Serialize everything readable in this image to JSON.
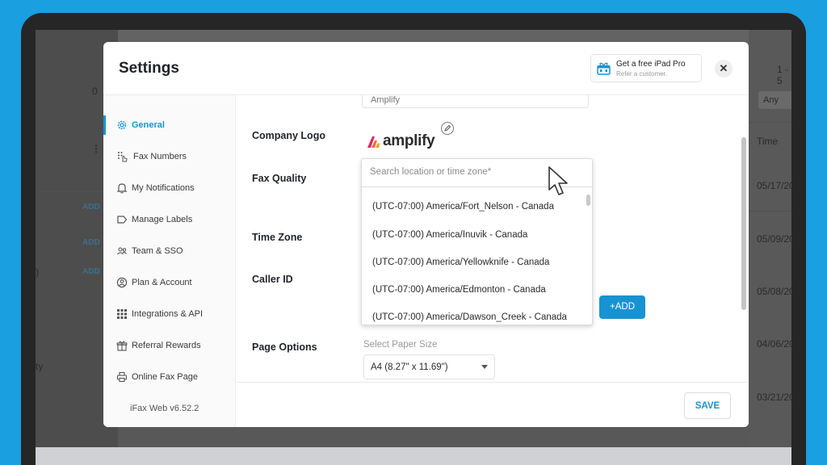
{
  "background_app": {
    "left_number": "0",
    "page_range": "1 - 5",
    "filter_label": "Any",
    "time_header": "Time",
    "add_links": [
      "ADD",
      "ADD",
      "ADD"
    ],
    "left_fragments": [
      ")",
      "ty"
    ],
    "dates": [
      "05/17/20",
      "05/09/20",
      "05/08/20",
      "04/06/20",
      "03/21/20"
    ]
  },
  "modal": {
    "title": "Settings",
    "promo": {
      "title": "Get a free iPad Pro",
      "subtitle": "Refer a customer."
    },
    "close_label": "✕"
  },
  "sidebar": {
    "items": [
      {
        "label": "General",
        "icon": "gear-icon",
        "active": true
      },
      {
        "label": "Fax Numbers",
        "icon": "keypad-hand-icon"
      },
      {
        "label": "My Notifications",
        "icon": "bell-icon"
      },
      {
        "label": "Manage Labels",
        "icon": "tag-icon"
      },
      {
        "label": "Team & SSO",
        "icon": "users-icon"
      },
      {
        "label": "Plan & Account",
        "icon": "user-circle-icon"
      },
      {
        "label": "Integrations & API",
        "icon": "grid-icon"
      },
      {
        "label": "Referral Rewards",
        "icon": "gift-icon"
      },
      {
        "label": "Online Fax Page",
        "icon": "printer-icon"
      }
    ],
    "version": "iFax Web v6.52.2"
  },
  "form": {
    "company_name_value": "Amplify",
    "company_logo_label": "Company Logo",
    "logo_text": "amplify",
    "fax_quality_label": "Fax Quality",
    "time_zone_label": "Time Zone",
    "caller_id_label": "Caller ID",
    "page_options_label": "Page Options",
    "add_button": "+ADD",
    "paper_size_hint": "Select Paper Size",
    "paper_size_value": "A4 (8.27\" x 11.69\")",
    "save_button": "SAVE"
  },
  "timezone_dropdown": {
    "search_placeholder": "Search location or time zone*",
    "options": [
      "(UTC-07:00) America/Fort_Nelson - Canada",
      "(UTC-07:00) America/Inuvik - Canada",
      "(UTC-07:00) America/Yellowknife - Canada",
      "(UTC-07:00) America/Edmonton - Canada",
      "(UTC-07:00) America/Dawson_Creek - Canada"
    ]
  },
  "colors": {
    "accent": "#1793d1",
    "backdrop": "#1a9fe0",
    "logo_mark": "#e0245e"
  }
}
